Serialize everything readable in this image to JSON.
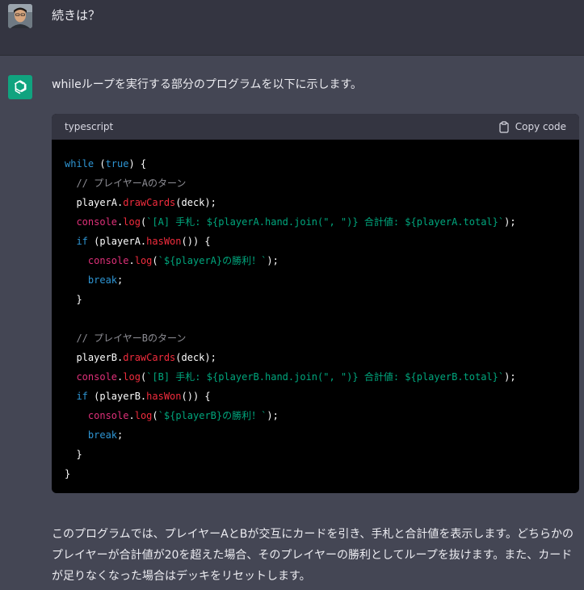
{
  "user": {
    "message": "続きは？"
  },
  "assistant": {
    "intro": "whileループを実行する部分のプログラムを以下に示します。",
    "code": {
      "language": "typescript",
      "copy_label": "Copy code"
    },
    "summary": "このプログラムでは、プレイヤーAとBが交互にカードを引き、手札と合計値を表示します。どちらかのプレイヤーが合計値が20を超えた場合、そのプレイヤーの勝利としてループを抜けます。また、カードが足りなくなった場合はデッキをリセットします。"
  },
  "code_lines": [
    [
      {
        "t": "while",
        "c": "kw"
      },
      {
        "t": " ("
      },
      {
        "t": "true",
        "c": "kw"
      },
      {
        "t": ") {"
      }
    ],
    [
      {
        "t": "  "
      },
      {
        "t": "// プレイヤーAのターン",
        "c": "cm"
      }
    ],
    [
      {
        "t": "  playerA."
      },
      {
        "t": "drawCards",
        "c": "fn"
      },
      {
        "t": "(deck);"
      }
    ],
    [
      {
        "t": "  "
      },
      {
        "t": "console",
        "c": "cn"
      },
      {
        "t": "."
      },
      {
        "t": "log",
        "c": "fn"
      },
      {
        "t": "("
      },
      {
        "t": "`[A] 手札: ${playerA.hand.join(\", \")} 合計値: ${playerA.total}`",
        "c": "str"
      },
      {
        "t": ");"
      }
    ],
    [
      {
        "t": "  "
      },
      {
        "t": "if",
        "c": "kw"
      },
      {
        "t": " (playerA."
      },
      {
        "t": "hasWon",
        "c": "fn"
      },
      {
        "t": "()) {"
      }
    ],
    [
      {
        "t": "    "
      },
      {
        "t": "console",
        "c": "cn"
      },
      {
        "t": "."
      },
      {
        "t": "log",
        "c": "fn"
      },
      {
        "t": "("
      },
      {
        "t": "`${playerA}の勝利！`",
        "c": "str"
      },
      {
        "t": ");"
      }
    ],
    [
      {
        "t": "    "
      },
      {
        "t": "break",
        "c": "kw"
      },
      {
        "t": ";"
      }
    ],
    [
      {
        "t": "  }"
      }
    ],
    [
      {
        "t": ""
      }
    ],
    [
      {
        "t": "  "
      },
      {
        "t": "// プレイヤーBのターン",
        "c": "cm"
      }
    ],
    [
      {
        "t": "  playerB."
      },
      {
        "t": "drawCards",
        "c": "fn"
      },
      {
        "t": "(deck);"
      }
    ],
    [
      {
        "t": "  "
      },
      {
        "t": "console",
        "c": "cn"
      },
      {
        "t": "."
      },
      {
        "t": "log",
        "c": "fn"
      },
      {
        "t": "("
      },
      {
        "t": "`[B] 手札: ${playerB.hand.join(\", \")} 合計値: ${playerB.total}`",
        "c": "str"
      },
      {
        "t": ");"
      }
    ],
    [
      {
        "t": "  "
      },
      {
        "t": "if",
        "c": "kw"
      },
      {
        "t": " (playerB."
      },
      {
        "t": "hasWon",
        "c": "fn"
      },
      {
        "t": "()) {"
      }
    ],
    [
      {
        "t": "    "
      },
      {
        "t": "console",
        "c": "cn"
      },
      {
        "t": "."
      },
      {
        "t": "log",
        "c": "fn"
      },
      {
        "t": "("
      },
      {
        "t": "`${playerB}の勝利！`",
        "c": "str"
      },
      {
        "t": ");"
      }
    ],
    [
      {
        "t": "    "
      },
      {
        "t": "break",
        "c": "kw"
      },
      {
        "t": ";"
      }
    ],
    [
      {
        "t": "  }"
      }
    ],
    [
      {
        "t": "}"
      }
    ]
  ],
  "colors": {
    "user_bg": "#343541",
    "assistant_bg": "#444654",
    "brand": "#10a37f",
    "keyword": "#2e95d3",
    "function": "#f22c3d",
    "console": "#df3079",
    "string": "#00a67d",
    "comment": "#8e8e95"
  },
  "icons": {
    "user_avatar": "user-avatar",
    "assistant_avatar": "openai-logo-icon",
    "copy": "clipboard-icon"
  }
}
